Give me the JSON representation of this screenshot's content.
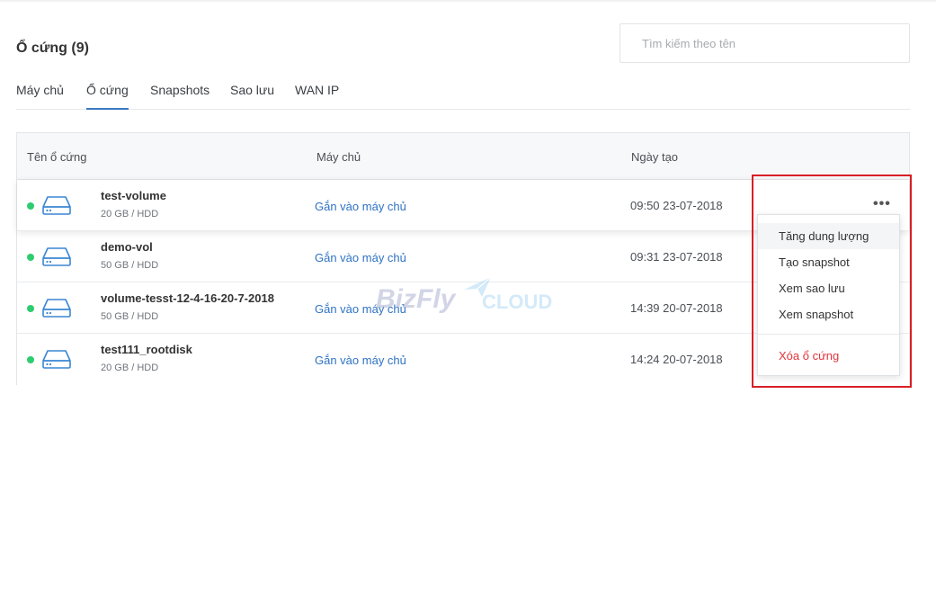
{
  "header": {
    "title": "Ổ cứng (9)"
  },
  "search": {
    "placeholder": "Tìm kiếm theo tên",
    "value": ""
  },
  "tabs": [
    {
      "label": "Máy chủ",
      "active": false
    },
    {
      "label": "Ổ cứng",
      "active": true
    },
    {
      "label": "Snapshots",
      "active": false
    },
    {
      "label": "Sao lưu",
      "active": false
    },
    {
      "label": "WAN IP",
      "active": false
    }
  ],
  "table": {
    "columns": [
      "Tên ổ cứng",
      "Máy chủ",
      "Ngày tạo"
    ],
    "rows": [
      {
        "name": "test-volume",
        "meta": "20 GB / HDD",
        "server": "Gắn vào máy chủ",
        "created": "09:50 23-07-2018",
        "status": "online"
      },
      {
        "name": "demo-vol",
        "meta": "50 GB / HDD",
        "server": "Gắn vào máy chủ",
        "created": "09:31 23-07-2018",
        "status": "online"
      },
      {
        "name": "volume-tesst-12-4-16-20-7-2018",
        "meta": "50 GB / HDD",
        "server": "Gắn vào máy chủ",
        "created": "14:39 20-07-2018",
        "status": "online"
      },
      {
        "name": "test111_rootdisk",
        "meta": "20 GB / HDD",
        "server": "Gắn vào máy chủ",
        "created": "14:24 20-07-2018",
        "status": "online"
      }
    ],
    "row_menu_icon": "more-horizontal-icon"
  },
  "dropdown": {
    "items": [
      {
        "label": "Tăng dung lượng"
      },
      {
        "label": "Tạo snapshot"
      },
      {
        "label": "Xem sao lưu"
      },
      {
        "label": "Xem snapshot"
      }
    ],
    "danger_item": {
      "label": "Xóa ổ cứng"
    }
  },
  "watermark": {
    "brand": "BizFly",
    "suffix": "CLOUD"
  },
  "colors": {
    "accent": "#3a78c2",
    "link": "#2f73c4",
    "status_online": "#2ecc71",
    "danger": "#e2333b",
    "highlight_box": "#d81f26"
  }
}
